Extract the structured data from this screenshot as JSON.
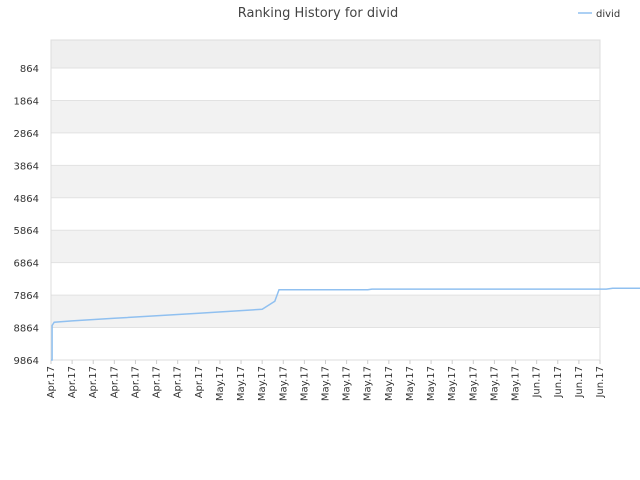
{
  "chart_data": {
    "type": "line",
    "title": "Ranking History for divid",
    "xlabel": "",
    "ylabel": "",
    "y_reversed": true,
    "ylim": [
      9864,
      0
    ],
    "y_ticks": [
      864,
      1864,
      2864,
      3864,
      4864,
      5864,
      6864,
      7864,
      8864,
      9864
    ],
    "x_tick_labels": [
      "Apr.17",
      "Apr.17",
      "Apr.17",
      "Apr.17",
      "Apr.17",
      "Apr.17",
      "Apr.17",
      "Apr.17",
      "May.17",
      "May.17",
      "May.17",
      "May.17",
      "May.17",
      "May.17",
      "May.17",
      "May.17",
      "May.17",
      "May.17",
      "May.17",
      "May.17",
      "May.17",
      "May.17",
      "May.17",
      "Jun.17",
      "Jun.17",
      "Jun.17",
      "Jun.17"
    ],
    "legend_position": "top-right",
    "grid": true,
    "series": [
      {
        "name": "divid",
        "color": "#90c0f0",
        "x": [
          0,
          0.05,
          0.05,
          0.15,
          1,
          3,
          5,
          7,
          9,
          10,
          10.6,
          10.8,
          14,
          15,
          15.2,
          20,
          25,
          26.3,
          26.6,
          29.3
        ],
        "values": [
          9864,
          9864,
          8800,
          8700,
          8660,
          8580,
          8500,
          8420,
          8340,
          8300,
          8050,
          7700,
          7700,
          7700,
          7680,
          7680,
          7680,
          7680,
          7650,
          7650
        ]
      }
    ]
  }
}
